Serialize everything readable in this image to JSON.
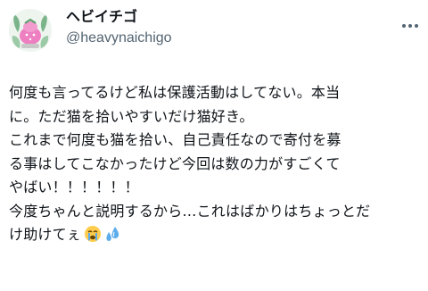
{
  "user": {
    "display_name": "ヘビイチゴ",
    "handle": "@heavynaichigo"
  },
  "icons": {
    "avatar": "avatar-image",
    "more": "more-options-icon",
    "emoji_crying": "loudly-crying-face-icon",
    "emoji_sweat": "sweat-droplets-icon"
  },
  "tweet": {
    "lines": [
      "何度も言ってるけど私は保護活動はしてない。本当",
      "に。ただ猫を拾いやすいだけ猫好き。",
      "これまで何度も猫を拾い、自己責任なので寄付を募",
      "る事はしてこなかったけど今回は数の力がすごくて",
      "やばい！！！！！！",
      "今度ちゃんと説明するから…これはばかりはちょっとだ",
      "け助けてぇ"
    ]
  },
  "colors": {
    "text": "#0f1419",
    "secondary": "#536471",
    "avatar_pink": "#ee7fc1"
  }
}
